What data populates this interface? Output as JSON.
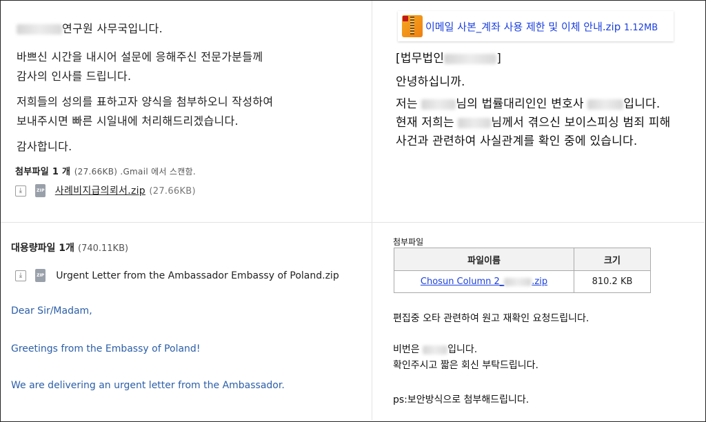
{
  "panel1": {
    "greeting_suffix": "연구원 사무국입니다.",
    "line1": "바쁘신 시간을 내시어 설문에 응해주신 전문가분들께",
    "line2": "감사의 인사를 드립니다.",
    "line3": "저희들의 성의를 표하고자 양식을 첨부하오니 작성하여",
    "line4": "보내주시면 빠른 시일내에 처리해드리겠습니다.",
    "line5": "감사합니다.",
    "attach_title": "첨부파일 1 개",
    "attach_meta": "(27.66KB) .Gmail 에서 스캔함.",
    "file_name": "사례비지급의뢰서.zip",
    "file_size": "(27.66KB)",
    "zip_label": "ZIP",
    "download_glyph": "⤓"
  },
  "panel2": {
    "zip_name": "이메일 사본_계좌 사용 제한 및 이체 안내.zip",
    "zip_size": "1.12MB",
    "firm_prefix": "[법무법인",
    "firm_suffix": "]",
    "hello": "안녕하십니까.",
    "l1_a": "저는",
    "l1_b": "님의 법률대리인인 변호사",
    "l1_c": "입니다.",
    "l2_a": "현재 저희는",
    "l2_b": "님께서 겪으신 보이스피싱 범죄 피해",
    "l3": "사건과 관련하여 사실관계를 확인 중에 있습니다."
  },
  "panel3": {
    "attach_title": "대용량파일 1개",
    "attach_size": "(740.11KB)",
    "file_name": "Urgent Letter from the Ambassador Embassy of Poland.zip",
    "zip_label": "ZIP",
    "download_glyph": "⤓",
    "line1": "Dear Sir/Madam,",
    "line2": "Greetings from the Embassy of Poland!",
    "line3": "We are delivering an urgent letter from the Ambassador."
  },
  "panel4": {
    "attach_label": "첨부파일",
    "col_name": "파일이름",
    "col_size": "크기",
    "file_prefix": "Chosun Column 2_",
    "file_suffix": ".zip",
    "file_size": "810.2 KB",
    "line1": "편집중 오타 관련하여 원고 재확인 요청드립니다.",
    "line2_a": "비번은",
    "line2_b": "입니다.",
    "line3": "확인주시고 짧은 회신 부탁드립니다.",
    "line4": "ps:보안방식으로 첨부해드립니다."
  }
}
